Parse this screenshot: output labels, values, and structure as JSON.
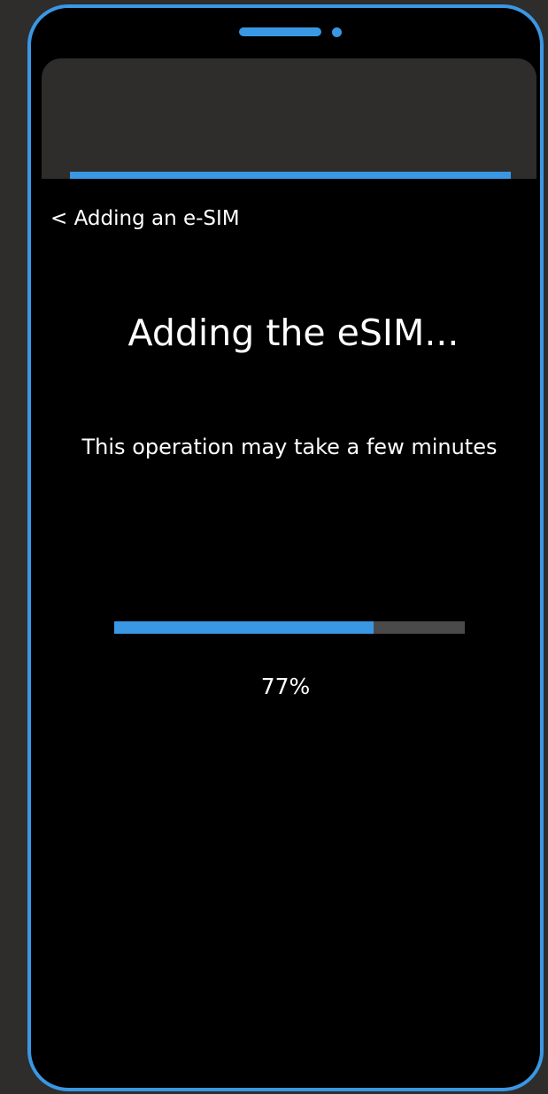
{
  "nav": {
    "back_label": "< Adding an e-SIM"
  },
  "main": {
    "title": "Adding the eSIM...",
    "subtitle": "This operation may take a few minutes"
  },
  "progress": {
    "percent": 74,
    "label": "77%"
  },
  "colors": {
    "accent": "#3a97e4",
    "background": "#000000",
    "frame_background": "#2e2d2c",
    "progress_track": "#4a4a4a",
    "text": "#ffffff"
  }
}
